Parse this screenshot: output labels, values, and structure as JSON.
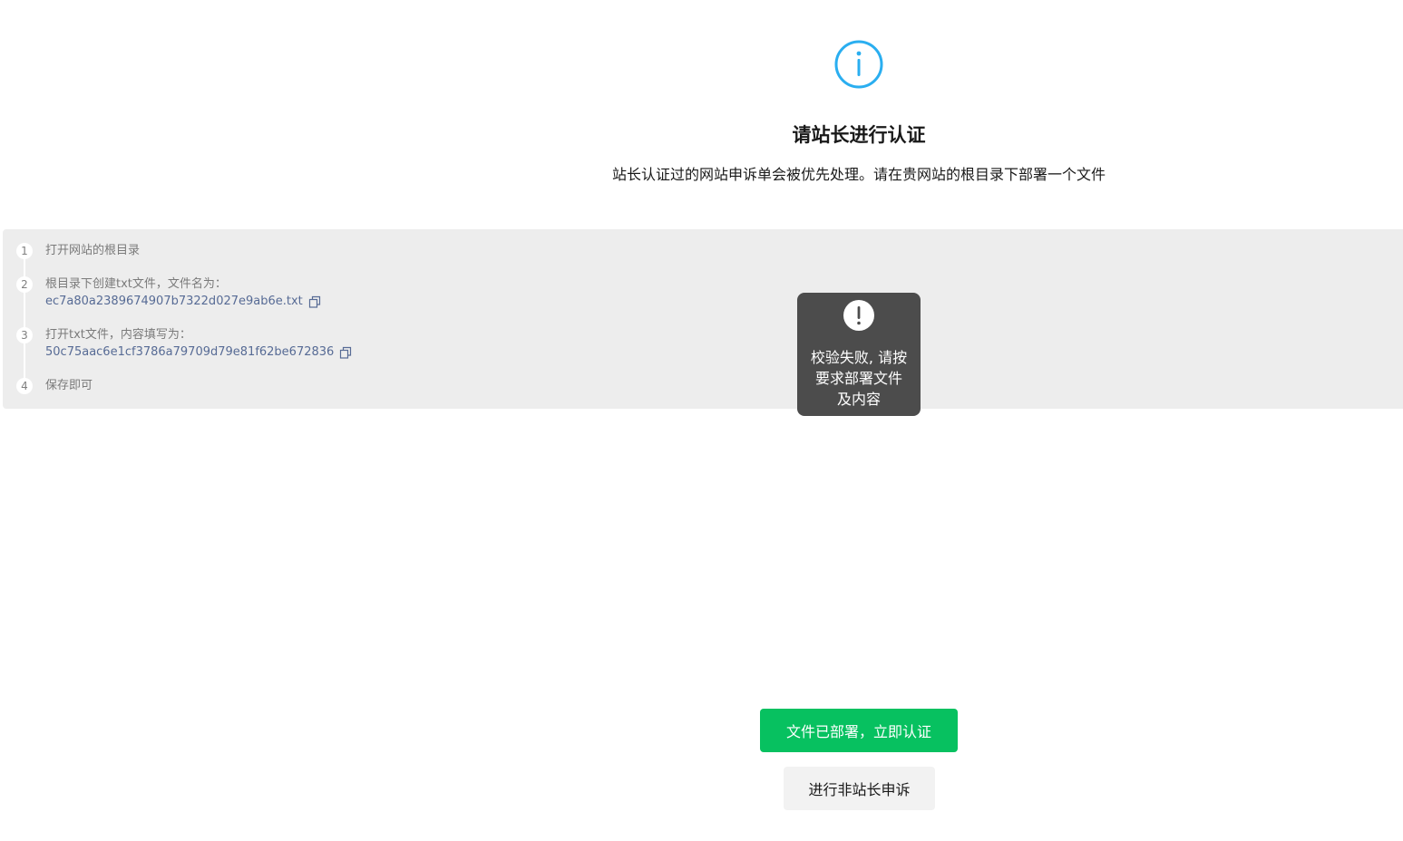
{
  "header": {
    "icon": "info-circle-icon",
    "title": "请站长进行认证",
    "description": "站长认证过的网站申诉单会被优先处理。请在贵网站的根目录下部署一个文件"
  },
  "steps": [
    {
      "number": "1",
      "text": "打开网站的根目录"
    },
    {
      "number": "2",
      "text": "根目录下创建txt文件，文件名为：",
      "value": "ec7a80a2389674907b7322d027e9ab6e.txt",
      "copy_icon": "copy-icon"
    },
    {
      "number": "3",
      "text": "打开txt文件，内容填写为：",
      "value": "50c75aac6e1cf3786a79709d79e81f62be672836",
      "copy_icon": "copy-icon"
    },
    {
      "number": "4",
      "text": "保存即可"
    }
  ],
  "toast": {
    "icon": "exclamation-circle-icon",
    "line1": "校验失败, 请按",
    "line2": "要求部署文件",
    "line3": "及内容"
  },
  "actions": {
    "primary_label": "文件已部署，立即认证",
    "secondary_label": "进行非站长申诉"
  },
  "colors": {
    "accent": "#07c160",
    "info_icon": "#2aaef0",
    "link": "#576b95",
    "panel_bg": "#ededed",
    "toast_bg": "#4c4c4c"
  }
}
